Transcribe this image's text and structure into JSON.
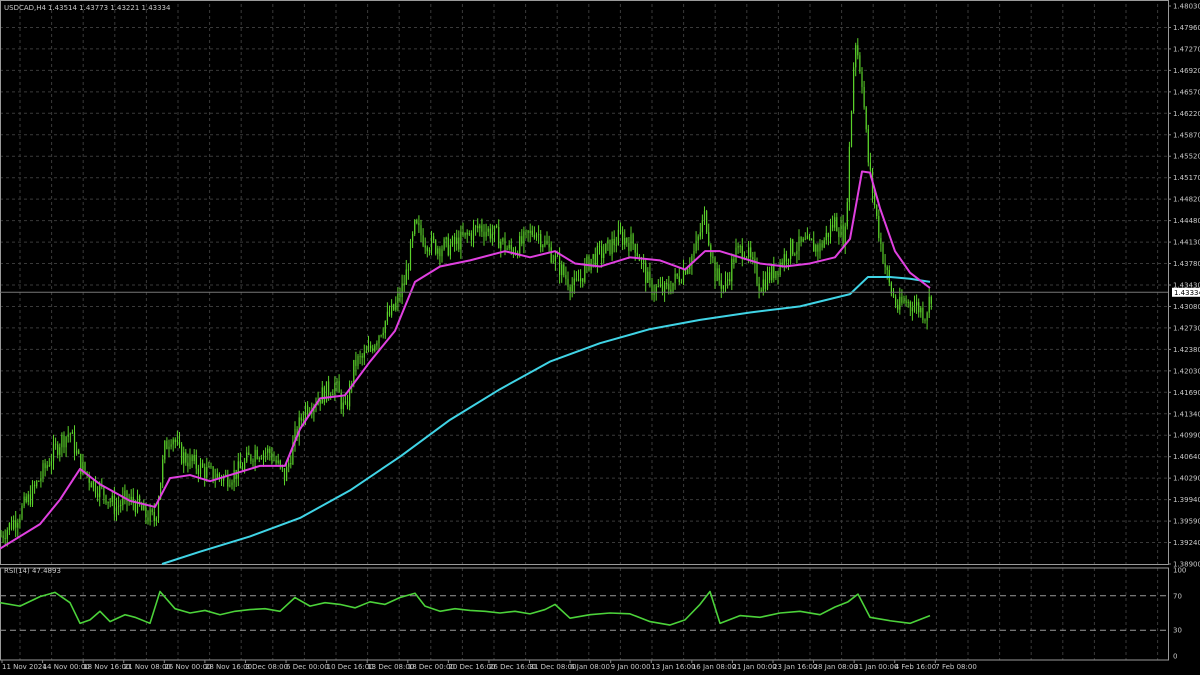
{
  "header": {
    "symbol": "USDCAD,H4",
    "ohlc": "1.43514 1.43773 1.43221 1.43334"
  },
  "rsi_panel": {
    "label": "RSI(14) 47.4893"
  },
  "current_price_label": "1.43334",
  "colors": {
    "background": "#000000",
    "grid": "#3a3a3a",
    "candle": "#5ad12a",
    "ma_fast": "#e040e0",
    "ma_slow": "#40d4e6",
    "rsi_line": "#4cd23a",
    "price_tag": "#ffffff"
  },
  "chart_data": [
    {
      "type": "line",
      "chart": "price",
      "ylim": [
        1.389,
        1.4803
      ],
      "y_ticks": [
        "1.48030",
        "1.47960",
        "1.47270",
        "1.46920",
        "1.46570",
        "1.46220",
        "1.45870",
        "1.45520",
        "1.45170",
        "1.44820",
        "1.44480",
        "1.44130",
        "1.43780",
        "1.43430",
        "1.43080",
        "1.42730",
        "1.42380",
        "1.42030",
        "1.41690",
        "1.41340",
        "1.40990",
        "1.40640",
        "1.40290",
        "1.39940",
        "1.39590",
        "1.39240",
        "1.38900"
      ],
      "x_ticks": [
        "11 Nov 2024",
        "14 Nov 00:00",
        "18 Nov 16:00",
        "21 Nov 08:00",
        "26 Nov 00:00",
        "28 Nov 16:00",
        "3 Dec 08:00",
        "6 Dec 00:00",
        "10 Dec 16:00",
        "13 Dec 08:00",
        "18 Dec 00:00",
        "20 Dec 16:00",
        "26 Dec 16:00",
        "31 Dec 08:00",
        "6 Jan 08:00",
        "9 Jan 00:00",
        "13 Jan 16:00",
        "16 Jan 08:00",
        "21 Jan 00:00",
        "23 Jan 16:00",
        "28 Jan 08:00",
        "31 Jan 00:00",
        "4 Feb 16:00",
        "7 Feb 08:00"
      ],
      "series": [
        {
          "role": "close",
          "x": [
            0,
            15,
            30,
            45,
            60,
            70,
            80,
            95,
            105,
            115,
            125,
            135,
            145,
            155,
            165,
            172,
            180,
            195,
            210,
            225,
            240,
            255,
            270,
            285,
            295,
            305,
            320,
            335,
            345,
            355,
            365,
            375,
            385,
            395,
            405,
            415,
            425,
            435,
            450,
            465,
            480,
            495,
            510,
            520,
            535,
            550,
            565,
            575,
            590,
            605,
            620,
            635,
            650,
            665,
            680,
            695,
            705,
            715,
            725,
            735,
            745,
            760,
            775,
            790,
            805,
            820,
            835,
            845,
            855,
            862,
            868,
            875,
            882,
            890,
            898,
            905,
            915,
            925,
            932
          ],
          "values": [
            1.3935,
            1.3962,
            1.3999,
            1.4046,
            1.409,
            1.4105,
            1.4052,
            1.4018,
            1.4005,
            1.3982,
            1.3994,
            1.399,
            1.397,
            1.3962,
            1.408,
            1.4103,
            1.4069,
            1.4052,
            1.4037,
            1.403,
            1.4043,
            1.4075,
            1.4072,
            1.4031,
            1.4095,
            1.4145,
            1.4163,
            1.4183,
            1.4137,
            1.4218,
            1.4227,
            1.4255,
            1.4285,
            1.4308,
            1.4352,
            1.444,
            1.4418,
            1.4408,
            1.4407,
            1.4422,
            1.444,
            1.4427,
            1.44,
            1.441,
            1.4436,
            1.44,
            1.4359,
            1.434,
            1.4386,
            1.44,
            1.4424,
            1.4411,
            1.4341,
            1.4335,
            1.4361,
            1.44,
            1.446,
            1.4363,
            1.434,
            1.4396,
            1.4405,
            1.4345,
            1.4369,
            1.4404,
            1.4411,
            1.4406,
            1.445,
            1.442,
            1.475,
            1.468,
            1.455,
            1.4471,
            1.44,
            1.4339,
            1.4307,
            1.4318,
            1.4313,
            1.4298,
            1.4333
          ]
        },
        {
          "role": "ma_fast",
          "x": [
            0,
            40,
            60,
            80,
            100,
            130,
            155,
            170,
            190,
            210,
            230,
            260,
            285,
            300,
            320,
            345,
            370,
            395,
            415,
            440,
            470,
            505,
            530,
            555,
            575,
            600,
            630,
            660,
            685,
            705,
            720,
            740,
            760,
            785,
            810,
            835,
            850,
            862,
            870,
            880,
            895,
            910,
            930
          ],
          "values": [
            1.3915,
            1.3955,
            1.3995,
            1.4045,
            1.402,
            1.3993,
            1.3983,
            1.403,
            1.4035,
            1.4025,
            1.4035,
            1.405,
            1.405,
            1.411,
            1.416,
            1.4165,
            1.422,
            1.427,
            1.435,
            1.4375,
            1.4385,
            1.44,
            1.439,
            1.44,
            1.438,
            1.4375,
            1.439,
            1.4385,
            1.437,
            1.44,
            1.44,
            1.439,
            1.438,
            1.4375,
            1.438,
            1.439,
            1.442,
            1.453,
            1.4528,
            1.447,
            1.44,
            1.4365,
            1.434
          ]
        },
        {
          "role": "ma_slow",
          "x": [
            162,
            200,
            250,
            300,
            350,
            400,
            450,
            500,
            550,
            600,
            650,
            700,
            750,
            800,
            850,
            868,
            890,
            910,
            930
          ],
          "values": [
            1.389,
            1.391,
            1.3935,
            1.3965,
            1.401,
            1.4065,
            1.4125,
            1.4175,
            1.422,
            1.425,
            1.4273,
            1.4288,
            1.43,
            1.431,
            1.433,
            1.4358,
            1.4358,
            1.4355,
            1.435
          ]
        }
      ]
    },
    {
      "type": "line",
      "chart": "rsi",
      "ylim": [
        0,
        100
      ],
      "y_ticks": [
        "100",
        "70",
        "30",
        "0"
      ],
      "levels": [
        70,
        30
      ],
      "series": [
        {
          "role": "rsi",
          "x": [
            0,
            20,
            40,
            55,
            70,
            80,
            90,
            100,
            110,
            125,
            135,
            150,
            160,
            175,
            190,
            205,
            220,
            235,
            250,
            265,
            280,
            295,
            310,
            325,
            340,
            355,
            370,
            385,
            400,
            415,
            425,
            440,
            455,
            470,
            485,
            500,
            515,
            530,
            545,
            555,
            570,
            590,
            610,
            630,
            650,
            670,
            685,
            700,
            710,
            720,
            740,
            760,
            780,
            800,
            820,
            835,
            848,
            858,
            870,
            890,
            910,
            930
          ],
          "values": [
            62,
            58,
            69,
            74,
            62,
            38,
            42,
            52,
            40,
            48,
            45,
            38,
            75,
            55,
            50,
            53,
            48,
            52,
            54,
            55,
            52,
            68,
            58,
            62,
            60,
            56,
            63,
            60,
            68,
            73,
            58,
            52,
            55,
            53,
            52,
            50,
            52,
            49,
            54,
            60,
            44,
            48,
            50,
            49,
            40,
            36,
            42,
            60,
            75,
            38,
            47,
            45,
            50,
            52,
            48,
            57,
            63,
            72,
            45,
            41,
            38,
            47
          ]
        }
      ]
    }
  ]
}
